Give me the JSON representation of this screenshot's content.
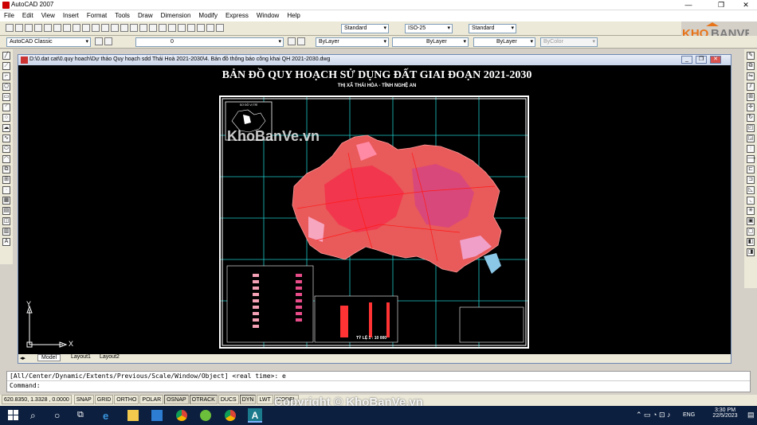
{
  "app": {
    "title": "AutoCAD 2007"
  },
  "menu": [
    "File",
    "Edit",
    "View",
    "Insert",
    "Format",
    "Tools",
    "Draw",
    "Dimension",
    "Modify",
    "Express",
    "Window",
    "Help"
  ],
  "toolbar": {
    "text_style": "Standard",
    "dim_style": "ISO-25",
    "table_style": "Standard",
    "workspace": "AutoCAD Classic",
    "layer": "0",
    "color": "ByLayer",
    "linetype": "ByLayer",
    "lineweight": "ByLayer",
    "plotstyle": "ByColor"
  },
  "watermark": {
    "logo": "KHOBANVE",
    "center": "KhoBanVe.vn",
    "copyright": "Copyright © KhoBanVe.vn"
  },
  "document": {
    "path": "D:\\0.dat cat\\0.quy hoach\\Dự thảo Quy hoạch sdd Thái Hoà 2021-2030\\4. Bản đồ thông báo công khai QH 2021-2030.dwg"
  },
  "map": {
    "title": "BẢN ĐỒ QUY HOẠCH  SỬ DỤNG ĐẤT GIAI ĐOẠN 2021-2030",
    "subtitle": "THỊ XÃ THÁI HÒA - TỈNH NGHỆ AN",
    "scale": "TỶ LỆ 1 : 10 000",
    "inset_label": "SƠ ĐỒ VỊ TRÍ"
  },
  "ucs": {
    "y": "Y",
    "x": "X"
  },
  "tabs": {
    "model": "Model",
    "layout1": "Layout1",
    "layout2": "Layout2"
  },
  "command": {
    "line1": "[All/Center/Dynamic/Extents/Previous/Scale/Window/Object] <real time>: e",
    "line2": "Command:"
  },
  "status": {
    "coords": "620.8350,  1.3328 , 0.0000",
    "buttons": [
      "SNAP",
      "GRID",
      "ORTHO",
      "POLAR",
      "OSNAP",
      "OTRACK",
      "DUCS",
      "DYN",
      "LWT",
      "MODEL"
    ]
  },
  "taskbar": {
    "lang": "ENG",
    "time": "3:30 PM",
    "date": "22/5/2023"
  }
}
